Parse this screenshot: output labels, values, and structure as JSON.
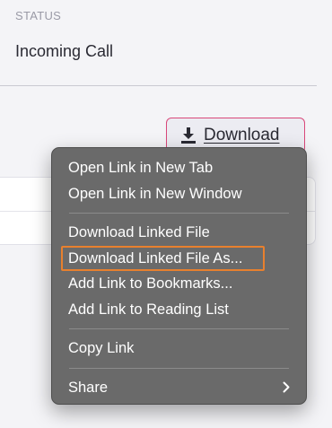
{
  "status": {
    "label": "STATUS",
    "value": "Incoming Call"
  },
  "download_button": {
    "label": "Download",
    "icon": "download-icon"
  },
  "context_menu": {
    "group1": [
      "Open Link in New Tab",
      "Open Link in New Window"
    ],
    "group2": [
      "Download Linked File",
      "Download Linked File As...",
      "Add Link to Bookmarks...",
      "Add Link to Reading List"
    ],
    "group3": [
      "Copy Link"
    ],
    "group4": [
      "Share"
    ],
    "highlighted_item": "Download Linked File As...",
    "highlight_color": "#e8802e",
    "submenu_icon": "chevron-right-icon"
  },
  "colors": {
    "background": "#f4f4f7",
    "menu_background": "#6a6a6a",
    "button_border": "#d9487a"
  }
}
